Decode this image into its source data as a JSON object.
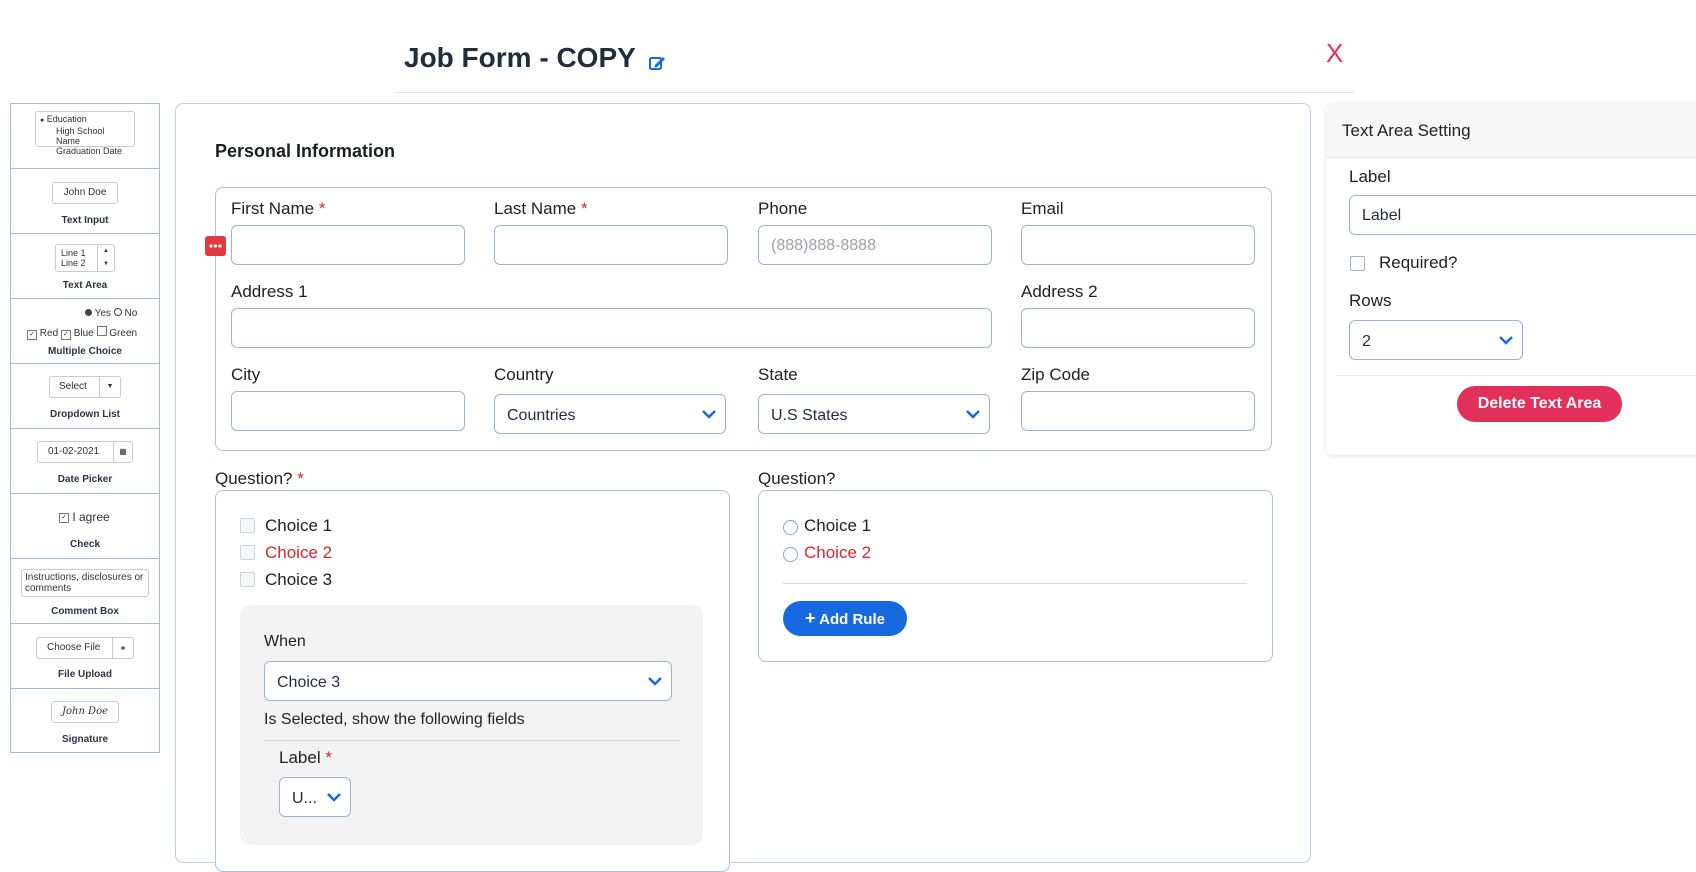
{
  "header": {
    "title": "Job Form - COPY",
    "close_label": "X"
  },
  "palette": {
    "education_preview": {
      "title": "Education",
      "line1": "High School Name",
      "line2": "Graduation Date"
    },
    "text_input": {
      "preview": "John Doe",
      "label": "Text Input"
    },
    "text_area": {
      "line1": "Line 1",
      "line2": "Line 2",
      "label": "Text Area"
    },
    "multiple_choice": {
      "yes": "Yes",
      "no": "No",
      "red": "Red",
      "blue": "Blue",
      "green": "Green",
      "label": "Multiple Choice"
    },
    "dropdown": {
      "preview": "Select",
      "label": "Dropdown List"
    },
    "date_picker": {
      "preview": "01-02-2021",
      "label": "Date Picker"
    },
    "check": {
      "preview": "I agree",
      "label": "Check"
    },
    "comment_box": {
      "preview": "Instructions, disclosures or comments",
      "label": "Comment Box"
    },
    "file_upload": {
      "preview": "Choose File",
      "label": "File Upload"
    },
    "signature": {
      "preview": "John Doe",
      "label": "Signature"
    }
  },
  "form": {
    "section_title": "Personal Information",
    "first_name": "First Name",
    "last_name": "Last Name",
    "phone": "Phone",
    "phone_placeholder": "(888)888-8888",
    "email": "Email",
    "address1": "Address 1",
    "address2": "Address 2",
    "city": "City",
    "country": "Country",
    "country_value": "Countries",
    "state": "State",
    "state_value": "U.S States",
    "zip": "Zip Code",
    "required_mark": "*"
  },
  "question1": {
    "label": "Question?",
    "choices": [
      "Choice 1",
      "Choice 2",
      "Choice 3"
    ],
    "rule": {
      "when": "When",
      "selected": "Choice 3",
      "is_selected_text": "Is Selected, show the following fields",
      "field_label": "Label",
      "field_select": "U..."
    }
  },
  "question2": {
    "label": "Question?",
    "choices": [
      "Choice 1",
      "Choice 2"
    ],
    "add_rule": "Add Rule"
  },
  "settings": {
    "title": "Text Area Setting",
    "label_caption": "Label",
    "label_value": "Label",
    "required_caption": "Required?",
    "rows_caption": "Rows",
    "rows_value": "2",
    "delete_label": "Delete Text Area"
  },
  "colors": {
    "accent_blue": "#1769e0",
    "danger": "#e3305a",
    "required_red": "#d9262e"
  }
}
